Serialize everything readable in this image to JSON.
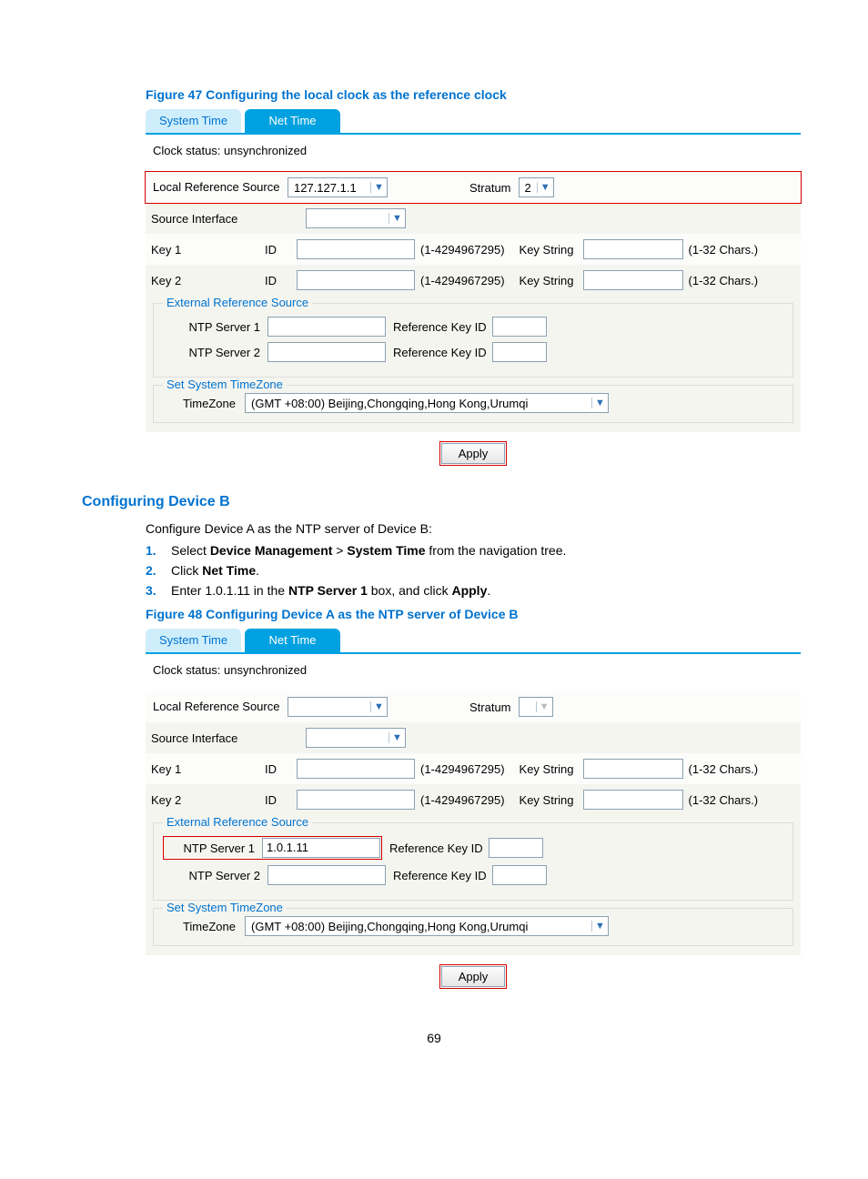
{
  "figure47": {
    "caption": "Figure 47 Configuring the local clock as the reference clock",
    "tabs": {
      "system_time": "System Time",
      "net_time": "Net Time"
    },
    "clock_status": "Clock status: unsynchronized",
    "local_ref_label": "Local Reference Source",
    "local_ref_value": "127.127.1.1",
    "stratum_label": "Stratum",
    "stratum_value": "2",
    "source_interface_label": "Source Interface",
    "source_interface_value": "",
    "key1_label": "Key 1",
    "key2_label": "Key 2",
    "id_label": "ID",
    "id_hint": "(1-4294967295)",
    "keystring_label": "Key String",
    "keystring_hint": "(1-32 Chars.)",
    "ext_ref_legend": "External Reference Source",
    "ntp1_label": "NTP Server 1",
    "ntp1_value": "",
    "ntp2_label": "NTP Server 2",
    "ntp2_value": "",
    "ref_key_id_label": "Reference Key ID",
    "tz_legend": "Set System TimeZone",
    "tz_label": "TimeZone",
    "tz_value": "(GMT +08:00) Beijing,Chongqing,Hong Kong,Urumqi",
    "apply": "Apply"
  },
  "section_heading": "Configuring Device B",
  "intro_text": "Configure Device A as the NTP server of Device B:",
  "steps": {
    "n1": "1.",
    "s1_a": "Select ",
    "s1_b": "Device Management",
    "s1_c": " > ",
    "s1_d": "System Time",
    "s1_e": " from the navigation tree.",
    "n2": "2.",
    "s2_a": "Click ",
    "s2_b": "Net Time",
    "s2_c": ".",
    "n3": "3.",
    "s3_a": "Enter 1.0.1.11 in the ",
    "s3_b": "NTP Server 1",
    "s3_c": " box, and click ",
    "s3_d": "Apply",
    "s3_e": "."
  },
  "figure48": {
    "caption": "Figure 48 Configuring Device A as the NTP server of Device B",
    "tabs": {
      "system_time": "System Time",
      "net_time": "Net Time"
    },
    "clock_status": "Clock status: unsynchronized",
    "local_ref_label": "Local Reference Source",
    "local_ref_value": "",
    "stratum_label": "Stratum",
    "stratum_value": "",
    "source_interface_label": "Source Interface",
    "source_interface_value": "",
    "key1_label": "Key 1",
    "key2_label": "Key 2",
    "id_label": "ID",
    "id_hint": "(1-4294967295)",
    "keystring_label": "Key String",
    "keystring_hint": "(1-32 Chars.)",
    "ext_ref_legend": "External Reference Source",
    "ntp1_label": "NTP Server 1",
    "ntp1_value": "1.0.1.11",
    "ntp2_label": "NTP Server 2",
    "ntp2_value": "",
    "ref_key_id_label": "Reference Key ID",
    "tz_legend": "Set System TimeZone",
    "tz_label": "TimeZone",
    "tz_value": "(GMT +08:00) Beijing,Chongqing,Hong Kong,Urumqi",
    "apply": "Apply"
  },
  "page_number": "69"
}
